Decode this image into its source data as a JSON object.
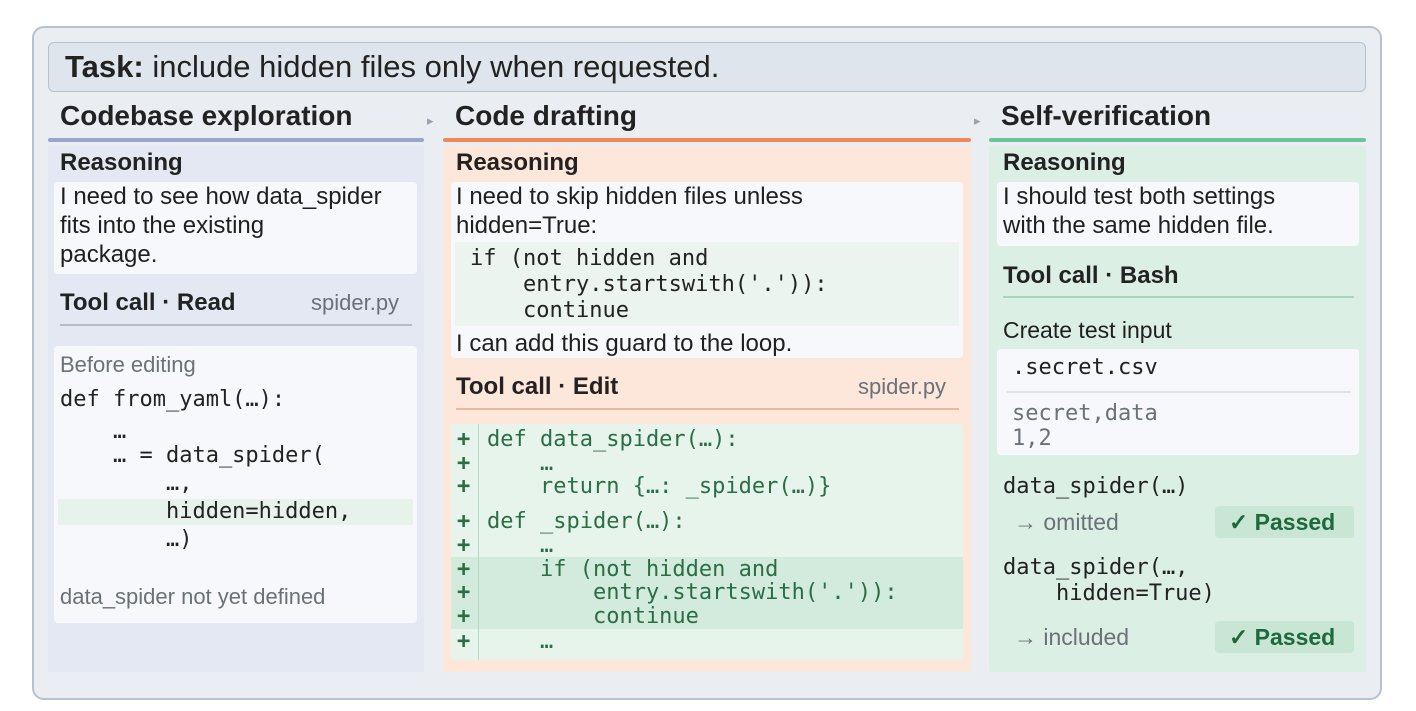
{
  "task": {
    "label": "Task:",
    "text": "include hidden files only when requested."
  },
  "columns": {
    "exploration": {
      "title": "Codebase exploration",
      "color": "#9aa6cc"
    },
    "drafting": {
      "title": "Code drafting",
      "color": "#f08a55"
    },
    "verification": {
      "title": "Self-verification",
      "color": "#6cc59a"
    }
  },
  "arrow_glyph": "▸",
  "exploration": {
    "reasoning_title": "Reasoning",
    "reasoning_lines": [
      "I need to see how data_spider",
      "fits into the existing",
      "package."
    ],
    "tool_label": "Tool call · Read",
    "tool_file": "spider.py",
    "before_label": "Before editing",
    "code_lines": [
      "def from_yaml(…):",
      "    …",
      "    … = data_spider(",
      "        …,",
      "        hidden=hidden,",
      "        …)"
    ],
    "note": "data_spider not yet defined"
  },
  "drafting": {
    "reasoning_title": "Reasoning",
    "reasoning_lines": [
      "I need to skip hidden files unless",
      "hidden=True:"
    ],
    "snippet_lines": [
      "if (not hidden and",
      "    entry.startswith('.')):",
      "    continue"
    ],
    "reasoning_after": "I can add this guard to the loop.",
    "tool_label": "Tool call · Edit",
    "tool_file": "spider.py",
    "diff_marker": "+",
    "diff_lines": [
      "def data_spider(…):",
      "    …",
      "    return {…: _spider(…)}",
      "def _spider(…):",
      "    …",
      "    if (not hidden and",
      "        entry.startswith('.')):",
      "        continue",
      "    …"
    ]
  },
  "verification": {
    "reasoning_title": "Reasoning",
    "reasoning_lines": [
      "I should test both settings",
      "with the same hidden file."
    ],
    "tool_label": "Tool call · Bash",
    "create_label": "Create test input",
    "filename": ".secret.csv",
    "file_lines": [
      "secret,data",
      "1,2"
    ],
    "call1": "data_spider(…)",
    "result1": "→ omitted",
    "call2_lines": [
      "data_spider(…,",
      "    hidden=True)"
    ],
    "result2": "→ included",
    "passed": "✓ Passed"
  }
}
